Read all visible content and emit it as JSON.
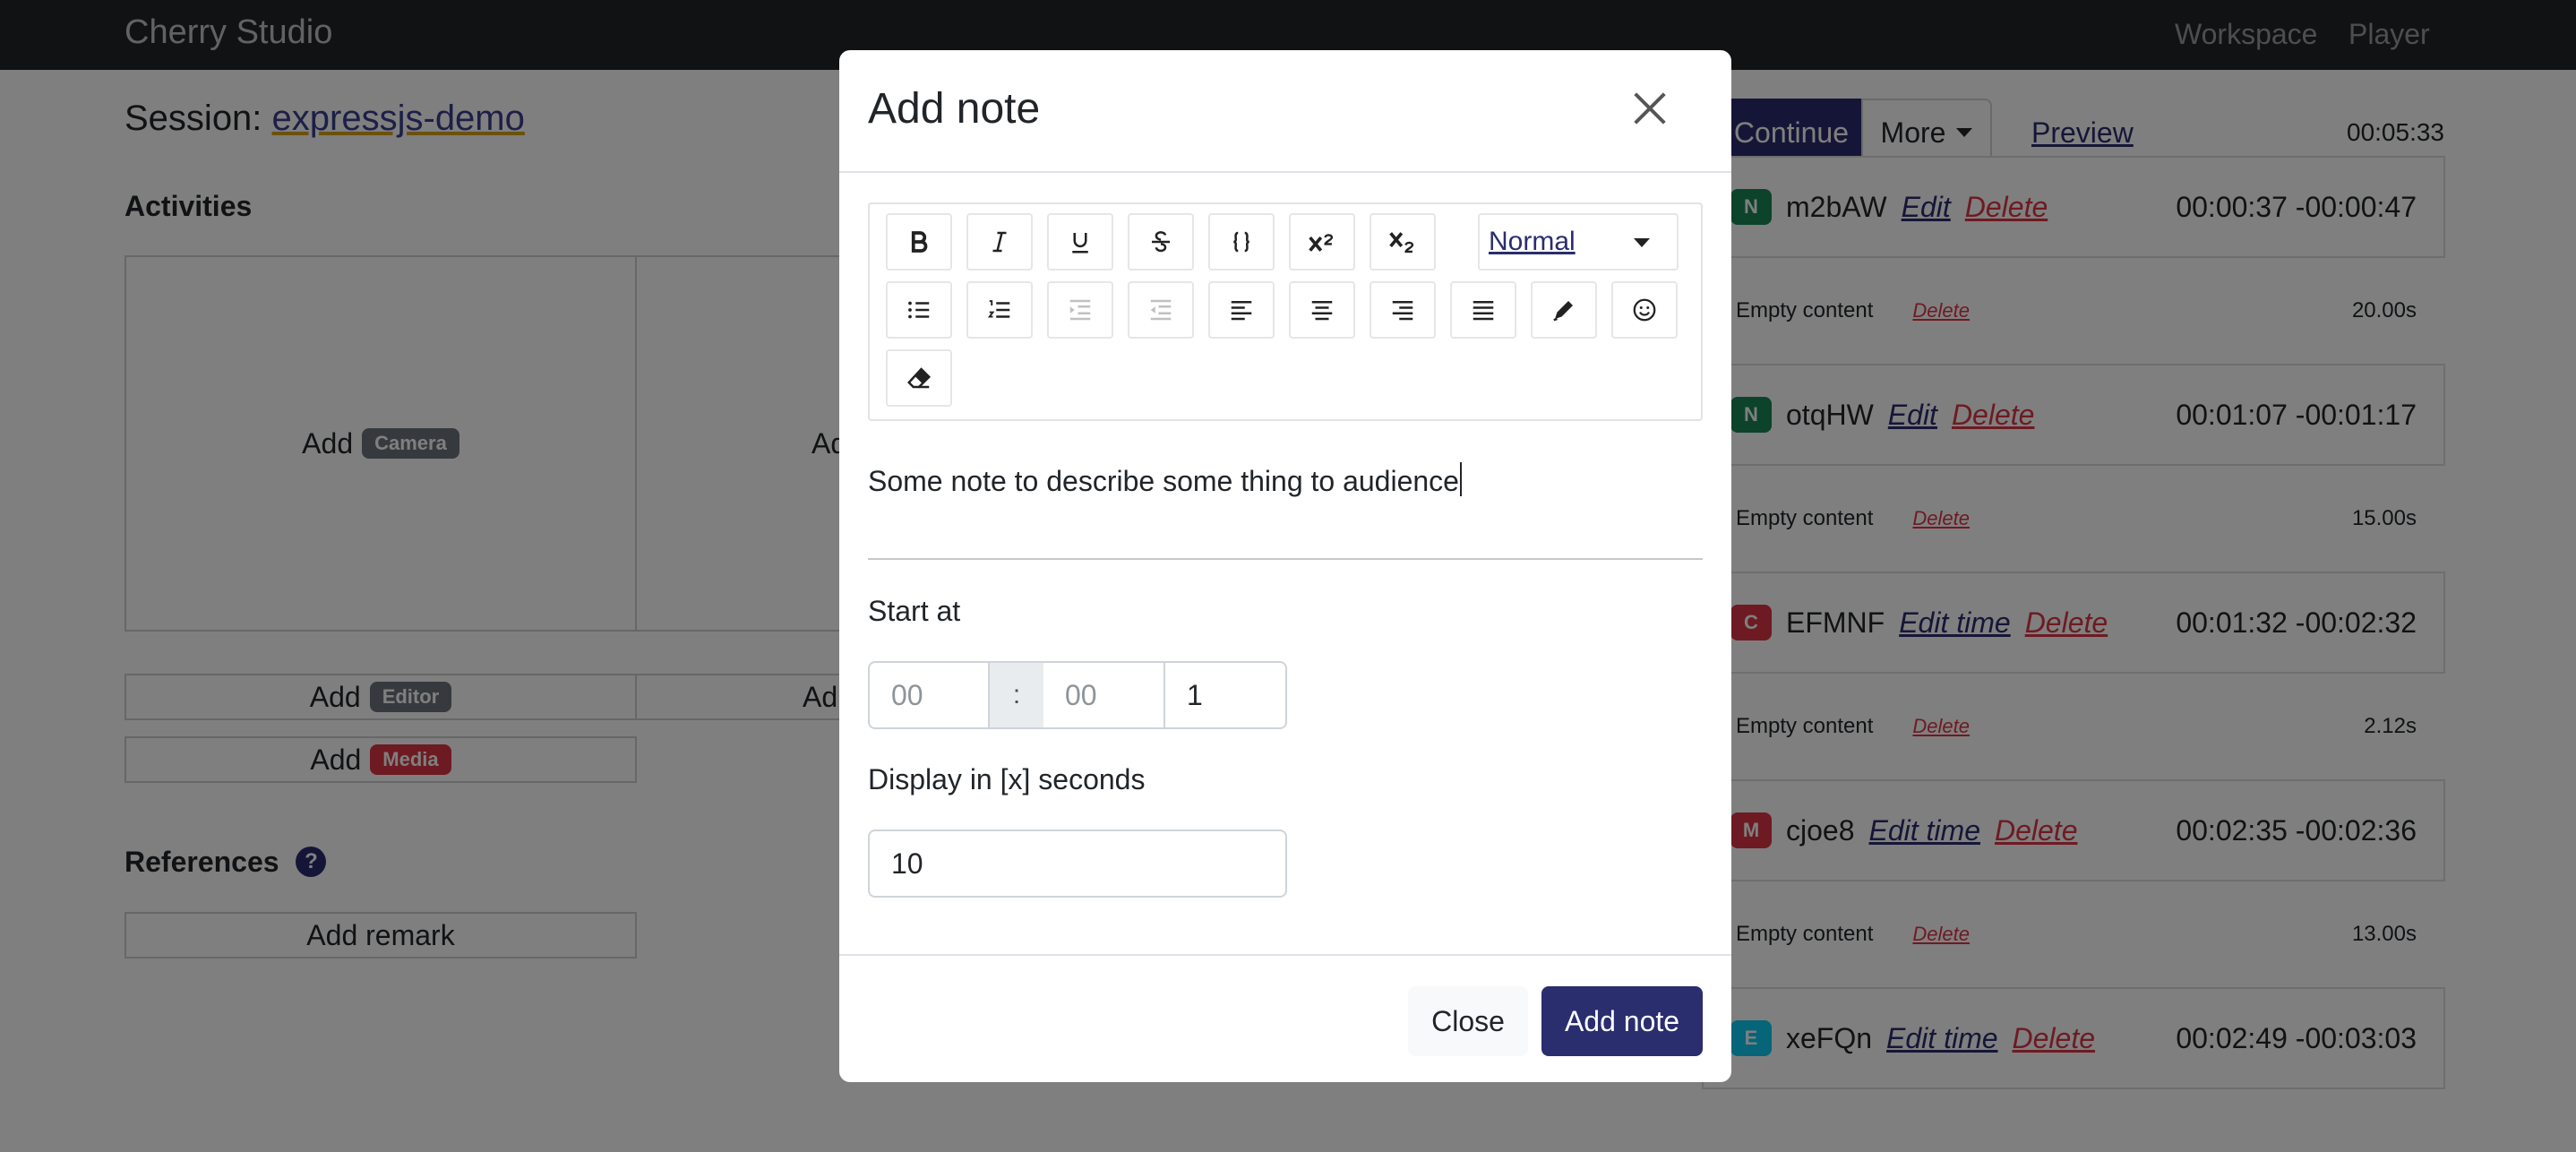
{
  "navbar": {
    "brand": "Cherry Studio",
    "links": [
      "Workspace",
      "Player"
    ]
  },
  "session": {
    "prefix": "Session:",
    "name": "expressjs-demo"
  },
  "activities": {
    "heading": "Activities",
    "add_label": "Add",
    "camera_badge": "Camera",
    "editor_badge": "Editor",
    "media_badge": "Media",
    "partial_add": "Ad"
  },
  "references": {
    "heading": "References",
    "help_icon": "?",
    "add_remark": "Add remark"
  },
  "controls": {
    "continue": "Continue",
    "more": "More",
    "preview": "Preview",
    "elapsed": "00:05:33"
  },
  "timeline": [
    {
      "type": "N",
      "color": "#198754",
      "id": "m2bAW",
      "edit": "Edit",
      "delete": "Delete",
      "time": "00:00:37 -00:00:47",
      "sub": "Empty content",
      "sub_delete": "Delete",
      "duration": "20.00s"
    },
    {
      "type": "N",
      "color": "#198754",
      "id": "otqHW",
      "edit": "Edit",
      "delete": "Delete",
      "time": "00:01:07 -00:01:17",
      "sub": "Empty content",
      "sub_delete": "Delete",
      "duration": "15.00s"
    },
    {
      "type": "C",
      "color": "#dc3545",
      "id": "EFMNF",
      "edit": "Edit time",
      "delete": "Delete",
      "time": "00:01:32 -00:02:32",
      "sub": "Empty content",
      "sub_delete": "Delete",
      "duration": "2.12s"
    },
    {
      "type": "M",
      "color": "#dc3545",
      "id": "cjoe8",
      "edit": "Edit time",
      "delete": "Delete",
      "time": "00:02:35 -00:02:36",
      "sub": "Empty content",
      "sub_delete": "Delete",
      "duration": "13.00s"
    },
    {
      "type": "E",
      "color": "#0dcaf0",
      "id": "xeFQn",
      "edit": "Edit time",
      "delete": "Delete",
      "time": "00:02:49 -00:03:03"
    }
  ],
  "modal": {
    "title": "Add note",
    "toolbar": {
      "header_select": "Normal"
    },
    "note_text": "Some note to describe some thing to audience",
    "start_at_label": "Start at",
    "start_minutes_placeholder": "00",
    "start_separator": ":",
    "start_seconds_placeholder": "00",
    "start_value": "1",
    "display_label": "Display in [x] seconds",
    "display_value": "10",
    "close_button": "Close",
    "submit_button": "Add note"
  },
  "colors": {
    "primary": "#2a2d6e",
    "danger": "#dc3545",
    "navbar": "#212529"
  }
}
